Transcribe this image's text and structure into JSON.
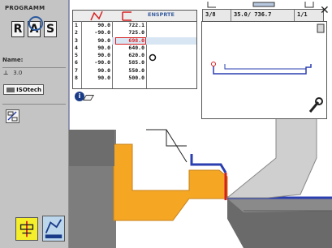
{
  "sidebar": {
    "program_label": "PROGRAMM",
    "logo_letters": [
      "R",
      "A",
      "S"
    ],
    "name_label": "Name:",
    "thickness_value": "3.0",
    "material": "ISOtech"
  },
  "table": {
    "header_title": "ENSPRTE",
    "rows": [
      {
        "idx": "1",
        "a": "90.0",
        "b": "722.1"
      },
      {
        "idx": "2",
        "a": "-90.0",
        "b": "725.0"
      },
      {
        "idx": "3",
        "a": "90.0",
        "b": "698.0"
      },
      {
        "idx": "4",
        "a": "90.0",
        "b": "640.0"
      },
      {
        "idx": "5",
        "a": "90.0",
        "b": "620.0"
      },
      {
        "idx": "6",
        "a": "-90.0",
        "b": "585.0"
      },
      {
        "idx": "7",
        "a": "90.0",
        "b": "550.0"
      },
      {
        "idx": "8",
        "a": "90.0",
        "b": "500.0"
      }
    ],
    "selected_row": 3
  },
  "toolbar": {
    "step": "3/8",
    "coords": "35.0/ 736.7",
    "page": "1/1"
  },
  "colors": {
    "sidebar_bg": "#c4c4c4",
    "workpiece_orange": "#f5a623",
    "profile_blue": "#2b3fb0",
    "accent_red": "#d62020",
    "machine_gray": "#7d7d7d"
  },
  "icons": [
    "bend-tool-icon",
    "angle-icon",
    "info-icon",
    "close-icon",
    "wrench-icon",
    "tool-setup-icon",
    "graphics-mode-icon"
  ]
}
